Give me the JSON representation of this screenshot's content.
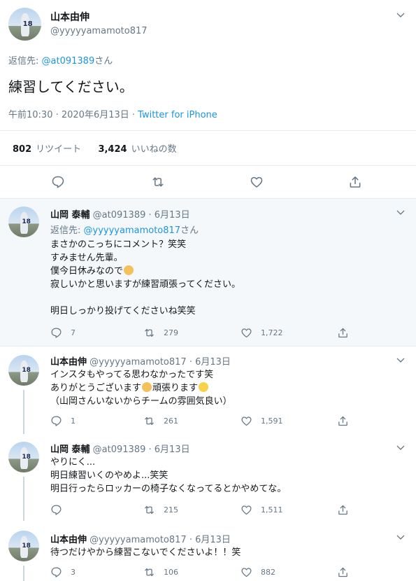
{
  "main": {
    "name": "山本由伸",
    "handle": "@yyyyyamamoto817",
    "reply_prefix": "返信先:",
    "reply_to": "@at091389",
    "reply_suffix": "さん",
    "text": "練習してください。",
    "time": "午前10:30 · 2020年6月13日",
    "source_sep": " · ",
    "source": "Twitter for iPhone",
    "retweets_count": "802",
    "retweets_label": "リツイート",
    "likes_count": "3,424",
    "likes_label": "いいねの数"
  },
  "replies": [
    {
      "name": "山岡 泰輔",
      "handle": "@at091389",
      "date": "· 6月13日",
      "reply_prefix": "返信先:",
      "reply_to": "@yyyyyamamoto817",
      "reply_suffix": "さん",
      "lines": [
        "まさかのこっちにコメント？笑笑",
        "すみません先輩。",
        "僕今日休みなので",
        "寂しいかと思いますが練習頑張ってください。",
        "",
        "明日しっかり投げてくださいね笑笑"
      ],
      "replies": "7",
      "retweets": "279",
      "likes": "1,722"
    },
    {
      "name": "山本由伸",
      "handle": "@yyyyyamamoto817",
      "date": "· 6月13日",
      "lines": [
        "インスタもやってる思わなかったです笑",
        "ありがとうございます",
        "頑張ります",
        "（山岡さんいないからチームの雰囲気良い）"
      ],
      "replies": "1",
      "retweets": "261",
      "likes": "1,591"
    },
    {
      "name": "山岡 泰輔",
      "handle": "@at091389",
      "date": "· 6月13日",
      "lines": [
        "やりにく...",
        "明日練習いくのやめよ...笑笑",
        "明日行ったらロッカーの椅子なくなってるとかやめてな。"
      ],
      "replies": "",
      "retweets": "215",
      "likes": "1,511"
    },
    {
      "name": "山本由伸",
      "handle": "@yyyyyamamoto817",
      "date": "· 6月13日",
      "lines": [
        "待つだけやから練習こないでくださいよ！！笑"
      ],
      "replies": "3",
      "retweets": "106",
      "likes": "882"
    }
  ],
  "avatar_number": "18",
  "icons": {
    "caret": "chevron-down-icon",
    "reply": "reply-icon",
    "retweet": "retweet-icon",
    "like": "heart-icon",
    "share": "share-icon",
    "emoji_person": "person-emoji",
    "emoji_face": "face-emoji"
  },
  "colors": {
    "link": "#1b95e0",
    "muted": "#657786",
    "highlight_bg": "#f5f8fa",
    "divider": "#e6ecf0"
  }
}
